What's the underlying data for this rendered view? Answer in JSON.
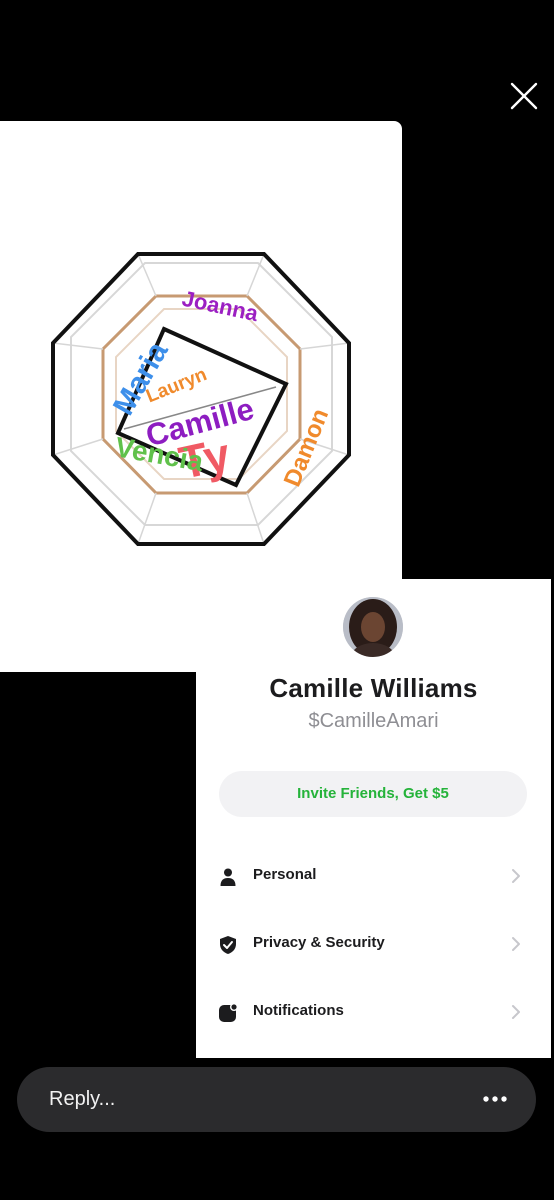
{
  "viewer": {
    "close_icon": "close-x-icon"
  },
  "meme": {
    "names": [
      "Joanna",
      "Maria",
      "Lauryn",
      "Camille",
      "Ty",
      "Damon",
      "Vencia"
    ],
    "colors": {
      "Joanna": "#9b1fc2",
      "Maria": "#3d8fea",
      "Lauryn": "#f08a2c",
      "Camille": "#8d1dc1",
      "Ty": "#f05a64",
      "Damon": "#f08a2c",
      "Vencia": "#60c14b"
    }
  },
  "profile": {
    "name": "Camille Williams",
    "handle": "$CamilleAmari",
    "invite_label": "Invite Friends, Get $5",
    "accent_color": "#25b33a",
    "menu": [
      {
        "label": "Personal",
        "icon": "person-icon"
      },
      {
        "label": "Privacy & Security",
        "icon": "shield-icon"
      },
      {
        "label": "Notifications",
        "icon": "notification-icon"
      }
    ]
  },
  "reply": {
    "placeholder": "Reply...",
    "more_icon": "more-dots-icon"
  }
}
